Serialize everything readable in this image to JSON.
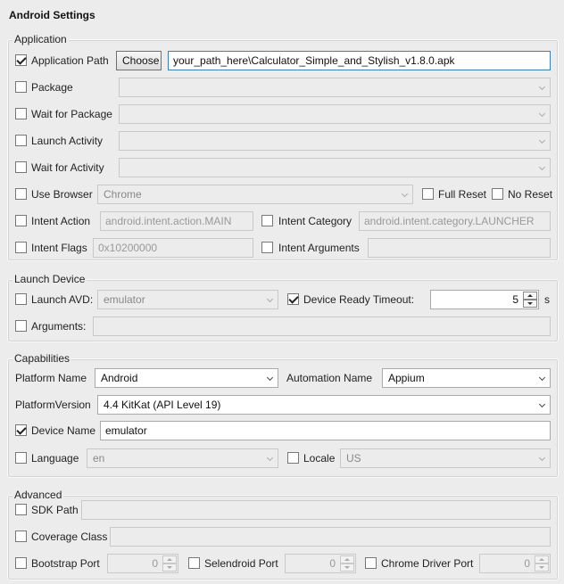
{
  "window": {
    "title": "Android Settings"
  },
  "application": {
    "legend": "Application",
    "app_path": {
      "label": "Application Path",
      "checked": true,
      "button": "Choose",
      "value": "your_path_here\\Calculator_Simple_and_Stylish_v1.8.0.apk"
    },
    "package": {
      "label": "Package",
      "checked": false,
      "value": ""
    },
    "wait_package": {
      "label": "Wait for Package",
      "checked": false,
      "value": ""
    },
    "launch_activity": {
      "label": "Launch Activity",
      "checked": false,
      "value": ""
    },
    "wait_activity": {
      "label": "Wait for Activity",
      "checked": false,
      "value": ""
    },
    "use_browser": {
      "label": "Use Browser",
      "checked": false,
      "value": "Chrome"
    },
    "full_reset": {
      "label": "Full Reset",
      "checked": false
    },
    "no_reset": {
      "label": "No Reset",
      "checked": false
    },
    "intent_action": {
      "label": "Intent Action",
      "checked": false,
      "value": "android.intent.action.MAIN"
    },
    "intent_category": {
      "label": "Intent Category",
      "checked": false,
      "value": "android.intent.category.LAUNCHER"
    },
    "intent_flags": {
      "label": "Intent Flags",
      "checked": false,
      "value": "0x10200000"
    },
    "intent_arguments": {
      "label": "Intent Arguments",
      "checked": false,
      "value": ""
    }
  },
  "launch_device": {
    "legend": "Launch Device",
    "launch_avd": {
      "label": "Launch AVD:",
      "checked": false,
      "value": "emulator"
    },
    "device_ready_timeout": {
      "label": "Device Ready Timeout:",
      "checked": true,
      "value": "5",
      "unit": "s"
    },
    "arguments": {
      "label": "Arguments:",
      "checked": false,
      "value": ""
    }
  },
  "capabilities": {
    "legend": "Capabilities",
    "platform_name": {
      "label": "Platform Name",
      "value": "Android"
    },
    "automation_name": {
      "label": "Automation Name",
      "value": "Appium"
    },
    "platform_version": {
      "label": "PlatformVersion",
      "value": "4.4 KitKat (API Level 19)"
    },
    "device_name": {
      "label": "Device Name",
      "checked": true,
      "value": "emulator"
    },
    "language": {
      "label": "Language",
      "checked": false,
      "value": "en"
    },
    "locale": {
      "label": "Locale",
      "checked": false,
      "value": "US"
    }
  },
  "advanced": {
    "legend": "Advanced",
    "sdk_path": {
      "label": "SDK Path",
      "checked": false,
      "value": ""
    },
    "coverage_class": {
      "label": "Coverage Class",
      "checked": false,
      "value": ""
    },
    "bootstrap_port": {
      "label": "Bootstrap Port",
      "checked": false,
      "value": "0"
    },
    "selendroid_port": {
      "label": "Selendroid Port",
      "checked": false,
      "value": "0"
    },
    "chrome_driver_port": {
      "label": "Chrome Driver Port",
      "checked": false,
      "value": "0"
    }
  }
}
